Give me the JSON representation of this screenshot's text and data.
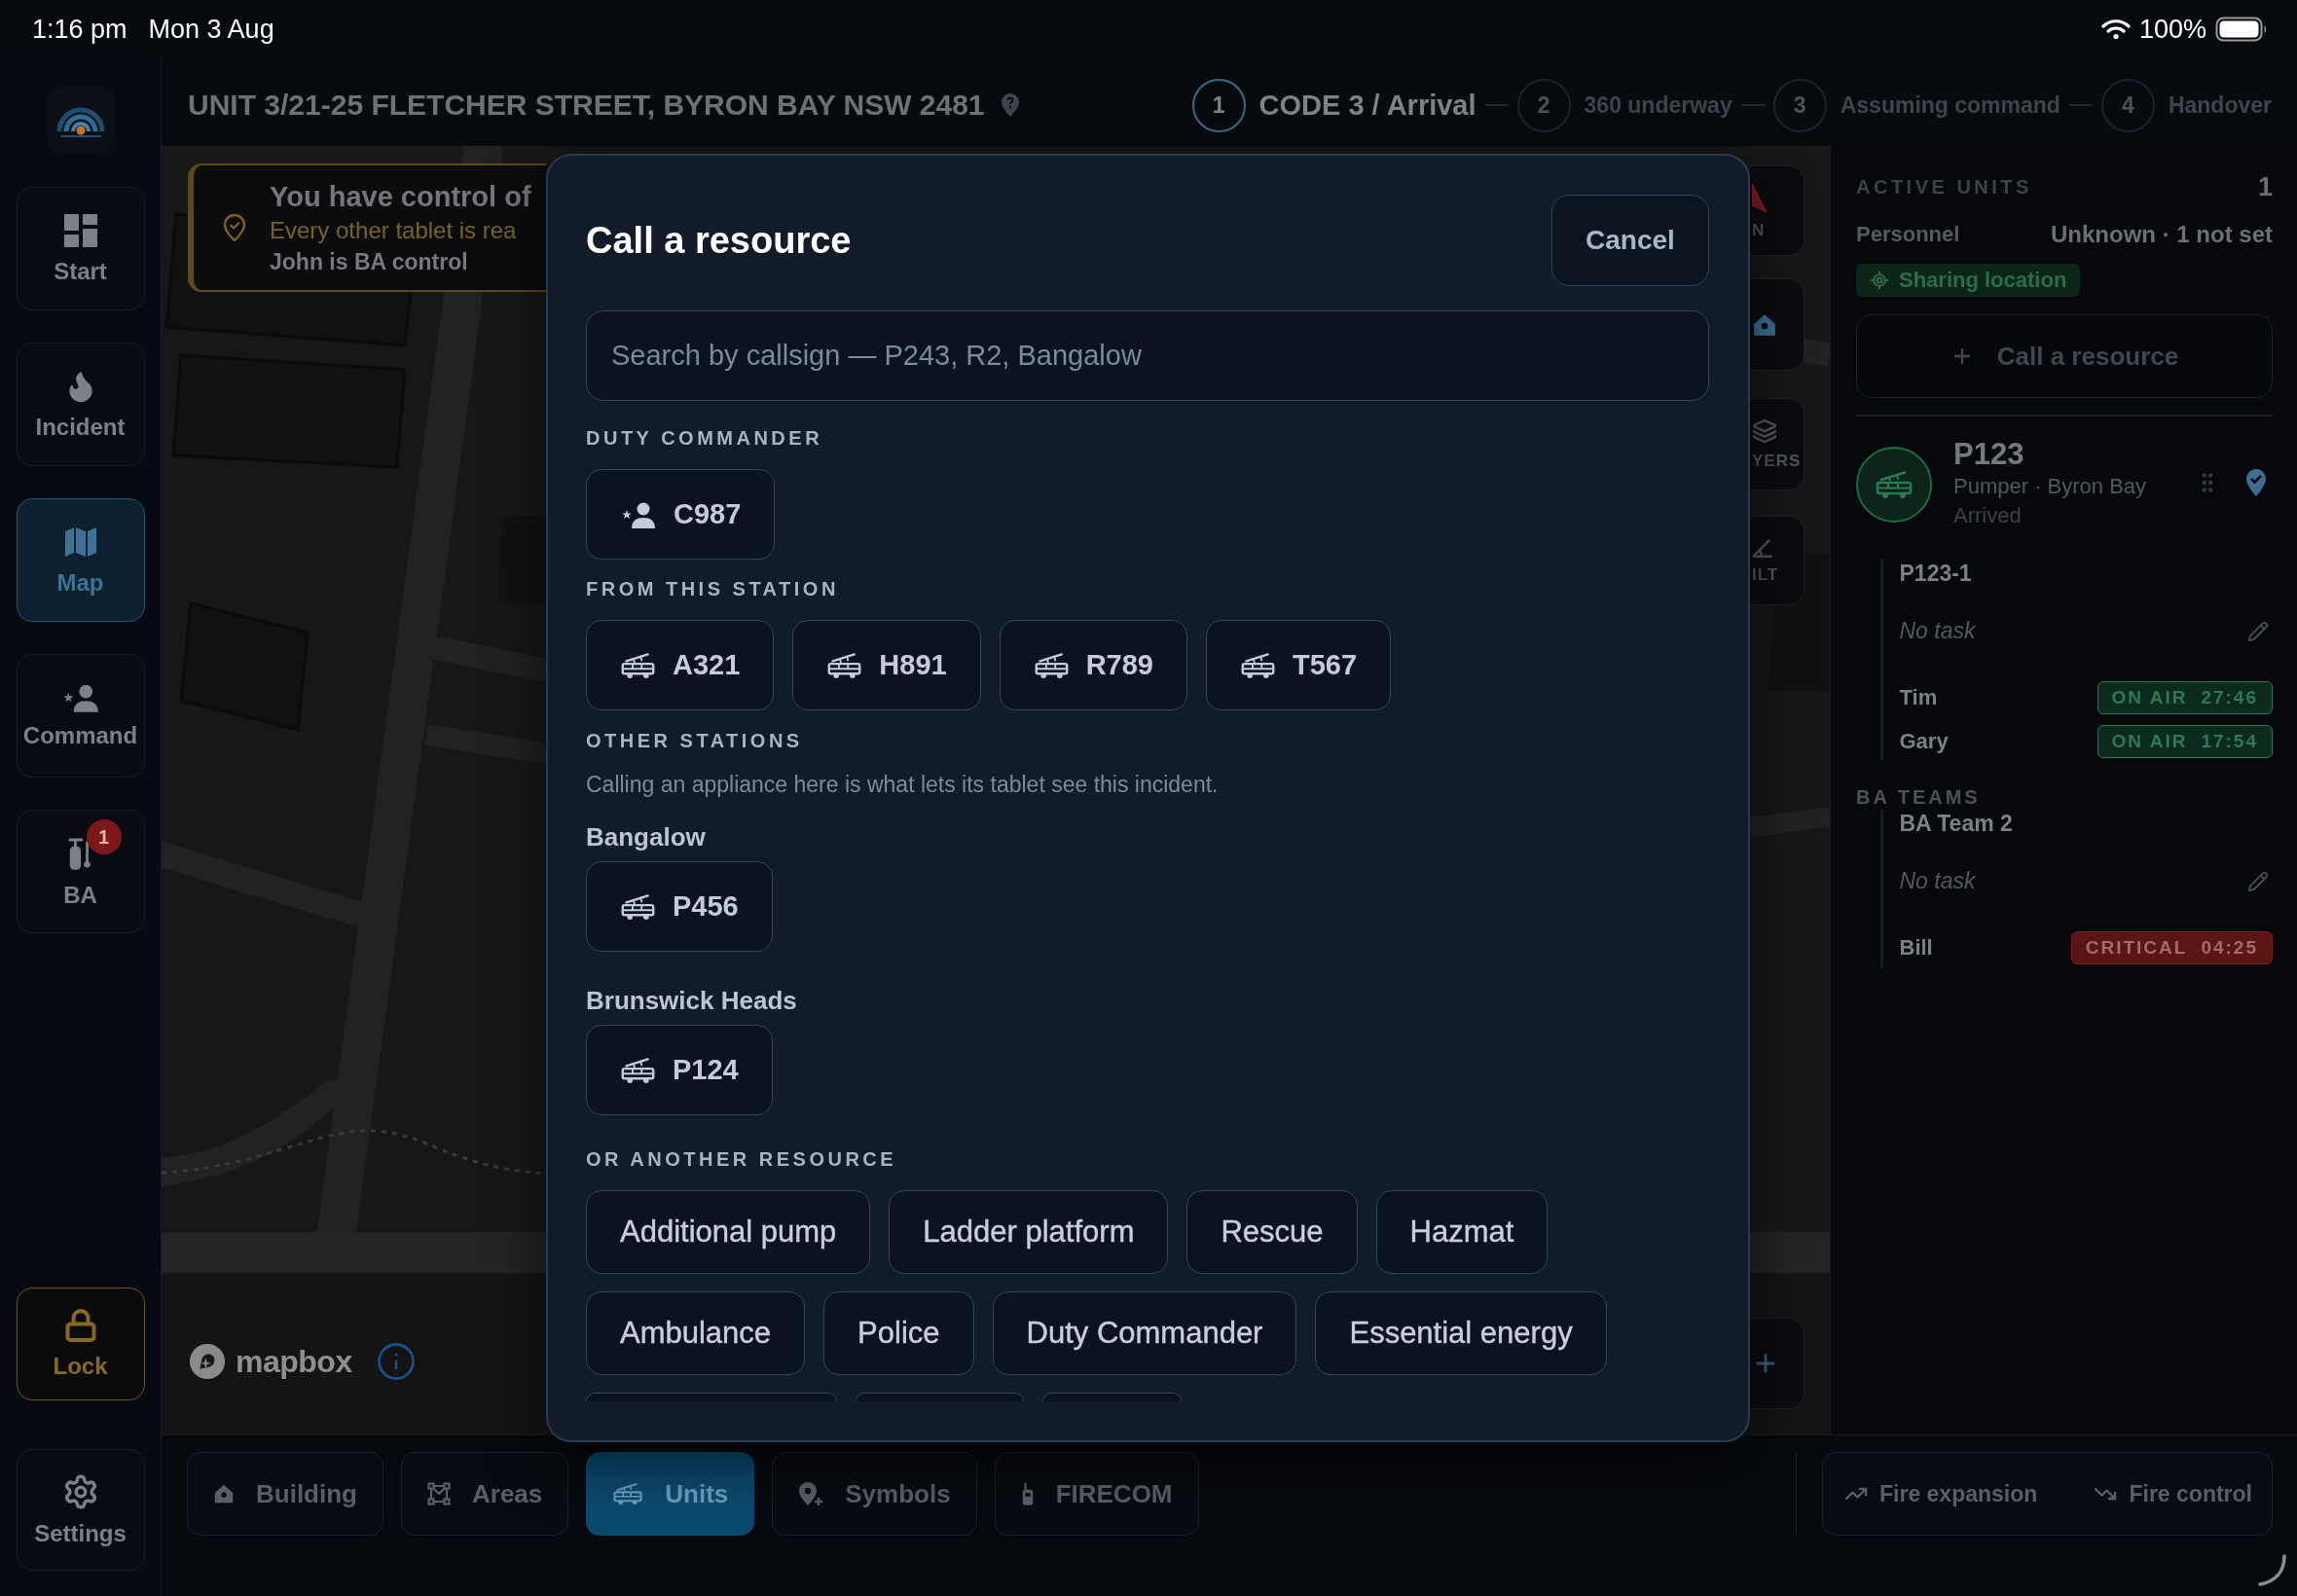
{
  "status_bar": {
    "time": "1:16 pm",
    "date": "Mon 3 Aug",
    "battery": "100%"
  },
  "sidebar": {
    "items": [
      {
        "label": "Start",
        "selected": false
      },
      {
        "label": "Incident",
        "selected": false
      },
      {
        "label": "Map",
        "selected": true
      },
      {
        "label": "Command",
        "selected": false
      },
      {
        "label": "BA",
        "selected": false,
        "badge": "1"
      }
    ],
    "lock": {
      "label": "Lock"
    },
    "settings": {
      "label": "Settings"
    }
  },
  "header": {
    "address": "UNIT 3/21-25 FLETCHER STREET, BYRON BAY NSW 2481",
    "steps": [
      {
        "number": "1",
        "label": "CODE 3 / Arrival",
        "selected": true
      },
      {
        "number": "2",
        "label": "360 underway",
        "selected": false
      },
      {
        "number": "3",
        "label": "Assuming command",
        "selected": false
      },
      {
        "number": "4",
        "label": "Handover",
        "selected": false
      }
    ]
  },
  "map": {
    "control_banner": {
      "title": "You have control of",
      "subtitle": "Every other tablet is rea",
      "note": "John is BA control"
    },
    "controls": [
      {
        "label": "N"
      },
      {
        "label": "YERS"
      },
      {
        "label": "ILT"
      }
    ],
    "attribution": "mapbox"
  },
  "dialog": {
    "title": "Call a resource",
    "cancel": "Cancel",
    "search_placeholder": "Search by callsign — P243, R2, Bangalow",
    "duty_commander": {
      "heading": "DUTY COMMANDER",
      "chips": [
        {
          "label": "C987",
          "kind": "commander"
        }
      ]
    },
    "this_station": {
      "heading": "FROM THIS STATION",
      "chips": [
        {
          "label": "A321",
          "kind": "appliance"
        },
        {
          "label": "H891",
          "kind": "appliance"
        },
        {
          "label": "R789",
          "kind": "appliance"
        },
        {
          "label": "T567",
          "kind": "appliance"
        }
      ]
    },
    "other_stations": {
      "heading": "OTHER STATIONS",
      "note": "Calling an appliance here is what lets its tablet see this incident.",
      "stations": [
        {
          "name": "Bangalow",
          "chips": [
            {
              "label": "P456",
              "kind": "appliance"
            }
          ]
        },
        {
          "name": "Brunswick Heads",
          "chips": [
            {
              "label": "P124",
              "kind": "appliance"
            }
          ]
        }
      ]
    },
    "other_resources": {
      "heading": "OR ANOTHER RESOURCE",
      "options": [
        "Additional pump",
        "Ladder platform",
        "Rescue",
        "Hazmat",
        "Ambulance",
        "Police",
        "Duty Commander",
        "Essential energy"
      ]
    }
  },
  "units_panel": {
    "heading": "ACTIVE UNITS",
    "count": "1",
    "personnel_label": "Personnel",
    "personnel_value": "Unknown · 1 not set",
    "location_badge": "Sharing location",
    "call_button": "Call a resource",
    "units": [
      {
        "callsign": "P123",
        "description": "Pumper · Byron Bay",
        "status": "Arrived",
        "crews": [
          {
            "name": "P123-1",
            "task": "No task",
            "members": [
              {
                "name": "Tim",
                "state": "ON AIR",
                "timer": "27:46",
                "kind": "on_air"
              },
              {
                "name": "Gary",
                "state": "ON AIR",
                "timer": "17:54",
                "kind": "on_air"
              }
            ]
          }
        ]
      }
    ],
    "ba_heading": "BA TEAMS",
    "ba_teams": [
      {
        "name": "BA Team 2",
        "task": "No task",
        "members": [
          {
            "name": "Bill",
            "state": "CRITICAL",
            "timer": "04:25",
            "kind": "critical"
          }
        ]
      }
    ]
  },
  "toolbar": {
    "tools": [
      {
        "label": "Building",
        "selected": false
      },
      {
        "label": "Areas",
        "selected": false
      },
      {
        "label": "Units",
        "selected": true
      },
      {
        "label": "Symbols",
        "selected": false
      },
      {
        "label": "FIRECOM",
        "selected": false
      }
    ],
    "fire_actions": [
      {
        "label": "Fire expansion"
      },
      {
        "label": "Fire control"
      }
    ]
  }
}
